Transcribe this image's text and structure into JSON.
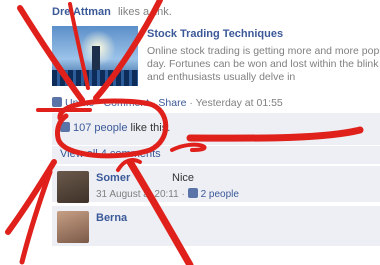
{
  "post": {
    "author": "Dre Attman",
    "action": "likes a link.",
    "link": {
      "title": "Stock Trading Techniques",
      "desc_lines": [
        "Online stock trading is getting more and more popu",
        "day. Fortunes can be won and lost within the blink",
        "and enthusiasts usually delve in"
      ]
    },
    "actions": {
      "unlike": "Unlike",
      "comment": "Comment",
      "share": "Share",
      "sep": "·",
      "time": "Yesterday at 01:55"
    },
    "likes_count": "107 people",
    "likes_suffix": "like this.",
    "view_comments": "View all 4 comments"
  },
  "comments": [
    {
      "author": "Somer",
      "text": "Nice",
      "time": "31 August at 20:11",
      "likes": "2 people"
    },
    {
      "author": "Berna",
      "text": "",
      "time": "",
      "likes": ""
    }
  ],
  "colors": {
    "annotation": "#e0201b",
    "link": "#3b5998",
    "box_bg": "#edeff4"
  }
}
